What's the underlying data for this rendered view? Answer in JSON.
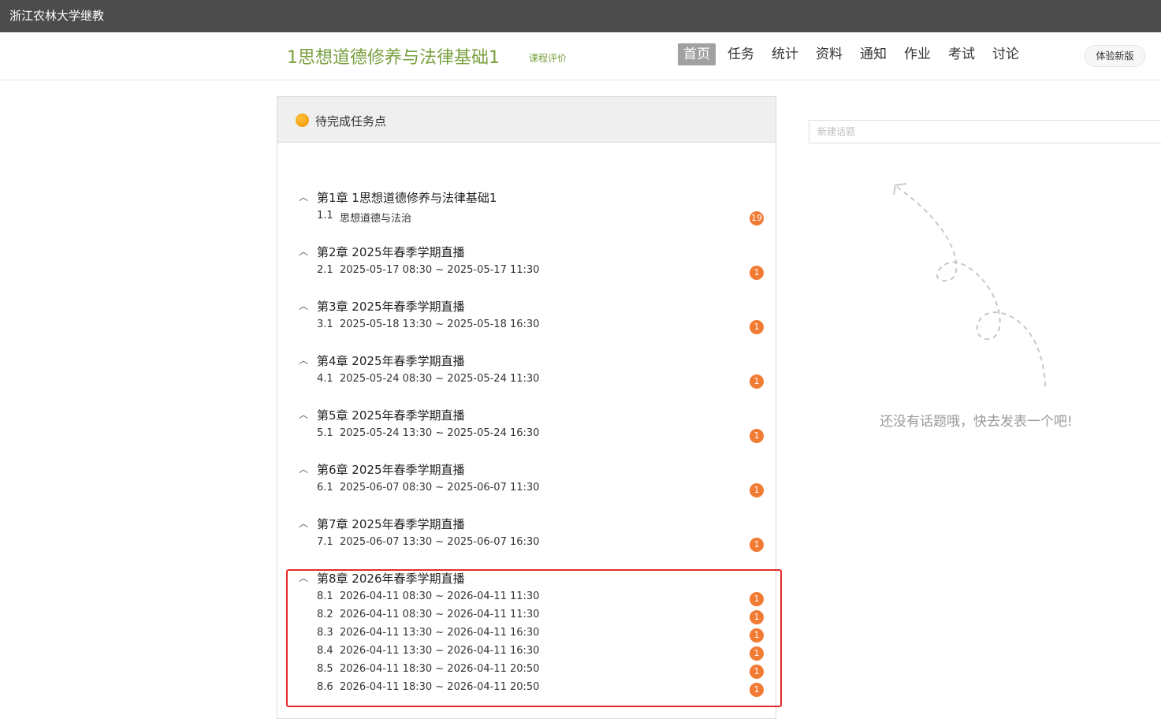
{
  "topbar": {
    "school": "浙江农林大学继教"
  },
  "header": {
    "course_title": "1思想道德修养与法律基础1",
    "course_eval": "课程评价",
    "nav": [
      "首页",
      "任务",
      "统计",
      "资料",
      "通知",
      "作业",
      "考试",
      "讨论"
    ],
    "new_version": "体验新版"
  },
  "panel": {
    "title": "待完成任务点",
    "chapters": [
      {
        "title": "第1章 1思想道德修养与法律基础1",
        "items": [
          {
            "num": "1.1",
            "text": "思想道德与法治",
            "badge": "19"
          }
        ]
      },
      {
        "title": "第2章 2025年春季学期直播",
        "items": [
          {
            "num": "2.1",
            "text": "2025-05-17 08:30 ~ 2025-05-17 11:30",
            "badge": "1"
          }
        ]
      },
      {
        "title": "第3章 2025年春季学期直播",
        "items": [
          {
            "num": "3.1",
            "text": "2025-05-18 13:30 ~ 2025-05-18 16:30",
            "badge": "1"
          }
        ]
      },
      {
        "title": "第4章 2025年春季学期直播",
        "items": [
          {
            "num": "4.1",
            "text": "2025-05-24 08:30 ~ 2025-05-24 11:30",
            "badge": "1"
          }
        ]
      },
      {
        "title": "第5章 2025年春季学期直播",
        "items": [
          {
            "num": "5.1",
            "text": "2025-05-24 13:30 ~ 2025-05-24 16:30",
            "badge": "1"
          }
        ]
      },
      {
        "title": "第6章 2025年春季学期直播",
        "items": [
          {
            "num": "6.1",
            "text": "2025-06-07 08:30 ~ 2025-06-07 11:30",
            "badge": "1"
          }
        ]
      },
      {
        "title": "第7章 2025年春季学期直播",
        "items": [
          {
            "num": "7.1",
            "text": "2025-06-07 13:30 ~ 2025-06-07 16:30",
            "badge": "1"
          }
        ]
      },
      {
        "title": "第8章 2026年春季学期直播",
        "items": [
          {
            "num": "8.1",
            "text": "2026-04-11 08:30 ~ 2026-04-11 11:30",
            "badge": "1"
          },
          {
            "num": "8.2",
            "text": "2026-04-11 08:30 ~ 2026-04-11 11:30",
            "badge": "1"
          },
          {
            "num": "8.3",
            "text": "2026-04-11 13:30 ~ 2026-04-11 16:30",
            "badge": "1"
          },
          {
            "num": "8.4",
            "text": "2026-04-11 13:30 ~ 2026-04-11 16:30",
            "badge": "1"
          },
          {
            "num": "8.5",
            "text": "2026-04-11 18:30 ~ 2026-04-11 20:50",
            "badge": "1"
          },
          {
            "num": "8.6",
            "text": "2026-04-11 18:30 ~ 2026-04-11 20:50",
            "badge": "1"
          }
        ]
      }
    ]
  },
  "discussion": {
    "placeholder": "新建话题",
    "empty_text": "还没有话题哦，快去发表一个吧!"
  },
  "colors": {
    "topbar": "#4c4c4c",
    "course_green": "#79a03f",
    "badge": "#f27b34",
    "highlight_red": "#e82a2a"
  }
}
